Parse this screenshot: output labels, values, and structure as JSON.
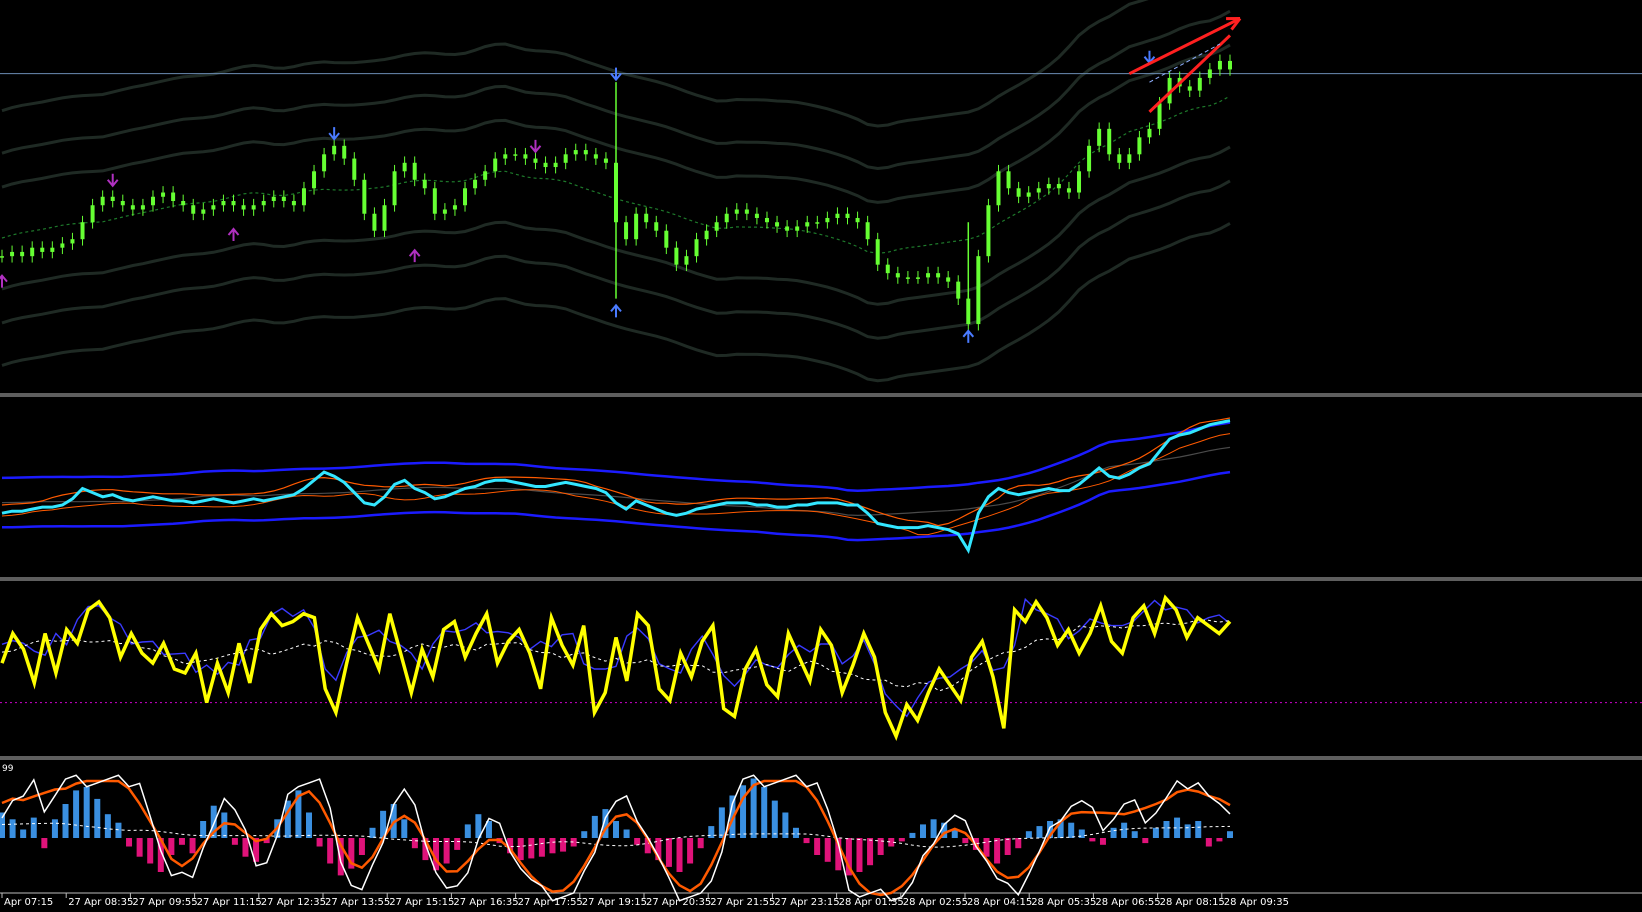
{
  "chart_data": {
    "type": "line",
    "title": "",
    "x_tick_labels": [
      "Apr 07:15",
      "27 Apr 08:35",
      "27 Apr 09:55",
      "27 Apr 11:15",
      "27 Apr 12:35",
      "27 Apr 13:55",
      "27 Apr 15:15",
      "27 Apr 16:35",
      "27 Apr 17:55",
      "27 Apr 19:15",
      "27 Apr 20:35",
      "27 Apr 21:55",
      "27 Apr 23:15",
      "28 Apr 01:35",
      "28 Apr 02:55",
      "28 Apr 04:15",
      "28 Apr 05:35",
      "28 Apr 06:55",
      "28 Apr 08:15",
      "28 Apr 09:35"
    ],
    "panels": [
      {
        "name": "price",
        "grid": false,
        "series": [
          {
            "kind": "price",
            "color": "#66ff33",
            "values": [
              62,
              63,
              62,
              64,
              63,
              64,
              65,
              66,
              70,
              74,
              76,
              75,
              74,
              73,
              74,
              76,
              77,
              75,
              74,
              72,
              73,
              74,
              75,
              74,
              73,
              74,
              75,
              76,
              75,
              74,
              78,
              82,
              86,
              88,
              85,
              80,
              72,
              68,
              74,
              82,
              84,
              80,
              78,
              72,
              73,
              74,
              78,
              80,
              82,
              85,
              86,
              86,
              85,
              84,
              83,
              84,
              86,
              87,
              86,
              85,
              84,
              70,
              66,
              72,
              70,
              68,
              64,
              60,
              62,
              66,
              68,
              70,
              72,
              73,
              72,
              71,
              70,
              69,
              68,
              69,
              70,
              70,
              71,
              72,
              71,
              70,
              66,
              60,
              58,
              57,
              57,
              57,
              58,
              57,
              56,
              52,
              46,
              62,
              74,
              82,
              78,
              76,
              77,
              78,
              79,
              78,
              77,
              82,
              88,
              92,
              86,
              84,
              86,
              90,
              92,
              98,
              104,
              102,
              101,
              104,
              106,
              108,
              106
            ]
          }
        ],
        "bands": {
          "upper_outer_color": "#1f2a24",
          "mid_color": "#1e7a2b"
        },
        "signals": {
          "up_arrows": [
            {
              "i": 61,
              "v": 49
            },
            {
              "i": 96,
              "v": 43
            }
          ],
          "down_arrows": [
            {
              "i": 33,
              "v": 91
            },
            {
              "i": 61,
              "v": 105
            },
            {
              "i": 114,
              "v": 109
            }
          ],
          "purple_up": [
            {
              "i": 0,
              "v": 56
            },
            {
              "i": 23,
              "v": 67
            },
            {
              "i": 41,
              "v": 62
            }
          ],
          "purple_down": [
            {
              "i": 11,
              "v": 80
            },
            {
              "i": 53,
              "v": 88
            }
          ]
        },
        "horizontal_line_value": 105,
        "trendlines": [
          {
            "color": "#ff2020",
            "from": {
              "i": 112,
              "v": 105
            },
            "to": {
              "i": 123,
              "v": 118
            },
            "arrow": true
          },
          {
            "color": "#ff2020",
            "from": {
              "i": 114,
              "v": 96
            },
            "to": {
              "i": 122,
              "v": 114
            },
            "arrow": false
          }
        ]
      },
      {
        "name": "oscillator-1",
        "grid": false,
        "colors": {
          "main": "#33e6ff",
          "band": "#1b1bff",
          "orange": "#ff5a00",
          "grey": "#4a4a4a"
        },
        "series_main": [
          40,
          41,
          41,
          42,
          43,
          43,
          44,
          47,
          52,
          50,
          48,
          49,
          47,
          46,
          47,
          48,
          47,
          46,
          46,
          45,
          46,
          47,
          46,
          45,
          46,
          47,
          46,
          47,
          48,
          49,
          52,
          56,
          60,
          58,
          55,
          50,
          45,
          44,
          48,
          54,
          56,
          52,
          50,
          47,
          48,
          50,
          52,
          53,
          55,
          56,
          56,
          55,
          54,
          53,
          53,
          54,
          55,
          54,
          53,
          52,
          50,
          45,
          42,
          46,
          44,
          42,
          40,
          39,
          40,
          42,
          43,
          44,
          45,
          45,
          45,
          44,
          44,
          43,
          43,
          44,
          44,
          45,
          45,
          45,
          44,
          44,
          40,
          35,
          34,
          33,
          33,
          33,
          34,
          33,
          32,
          30,
          22,
          40,
          48,
          52,
          50,
          49,
          50,
          51,
          52,
          51,
          51,
          54,
          58,
          62,
          58,
          57,
          59,
          62,
          64,
          70,
          76,
          78,
          79,
          81,
          83,
          84,
          85
        ]
      },
      {
        "name": "oscillator-2",
        "grid": false,
        "colors": {
          "main": "#ffff00",
          "fast": "#3a3aff",
          "signal": "#ffffff",
          "zero": "#cc00cc"
        },
        "series_main": [
          55,
          70,
          62,
          45,
          70,
          50,
          72,
          65,
          82,
          86,
          78,
          58,
          70,
          60,
          55,
          65,
          52,
          50,
          60,
          35,
          55,
          40,
          65,
          45,
          72,
          80,
          74,
          76,
          80,
          78,
          42,
          30,
          55,
          78,
          65,
          52,
          80,
          60,
          40,
          62,
          48,
          72,
          76,
          58,
          70,
          80,
          55,
          66,
          72,
          60,
          42,
          78,
          64,
          54,
          74,
          30,
          40,
          68,
          46,
          80,
          74,
          42,
          36,
          60,
          48,
          66,
          74,
          32,
          28,
          52,
          62,
          44,
          38,
          70,
          58,
          46,
          72,
          64,
          40,
          54,
          70,
          58,
          30,
          18,
          34,
          26,
          40,
          52,
          44,
          36,
          58,
          66,
          48,
          22,
          82,
          76,
          86,
          78,
          64,
          72,
          60,
          70,
          84,
          66,
          60,
          78,
          84,
          70,
          88,
          82,
          68,
          78,
          74,
          70,
          76
        ]
      },
      {
        "name": "oscillator-3",
        "grid": false,
        "colors": {
          "white": "#ffffff",
          "orange": "#ff5a00",
          "hist_pos": "#3a8fe0",
          "hist_neg": "#e0137a"
        },
        "label_value": "99",
        "histogram": [
          30,
          22,
          10,
          24,
          -12,
          22,
          40,
          56,
          60,
          46,
          28,
          18,
          -10,
          -22,
          -30,
          -40,
          -20,
          -8,
          -18,
          20,
          38,
          30,
          -8,
          -22,
          -28,
          -6,
          22,
          44,
          56,
          30,
          -10,
          -30,
          -44,
          -36,
          -20,
          12,
          32,
          40,
          22,
          -12,
          -26,
          -38,
          -30,
          -14,
          16,
          28,
          20,
          -6,
          -18,
          -26,
          -24,
          -22,
          -18,
          -16,
          -10,
          8,
          26,
          34,
          20,
          10,
          -8,
          -18,
          -26,
          -34,
          -40,
          -30,
          -12,
          14,
          36,
          50,
          62,
          70,
          60,
          44,
          30,
          12,
          -6,
          -20,
          -28,
          -38,
          -44,
          -40,
          -32,
          -20,
          -10,
          -4,
          6,
          16,
          22,
          18,
          10,
          -6,
          -14,
          -22,
          -30,
          -20,
          -12,
          8,
          14,
          20,
          22,
          18,
          10,
          -4,
          -8,
          12,
          18,
          8,
          -6,
          12,
          20,
          24,
          16,
          20,
          -10,
          -4,
          8
        ]
      }
    ]
  }
}
